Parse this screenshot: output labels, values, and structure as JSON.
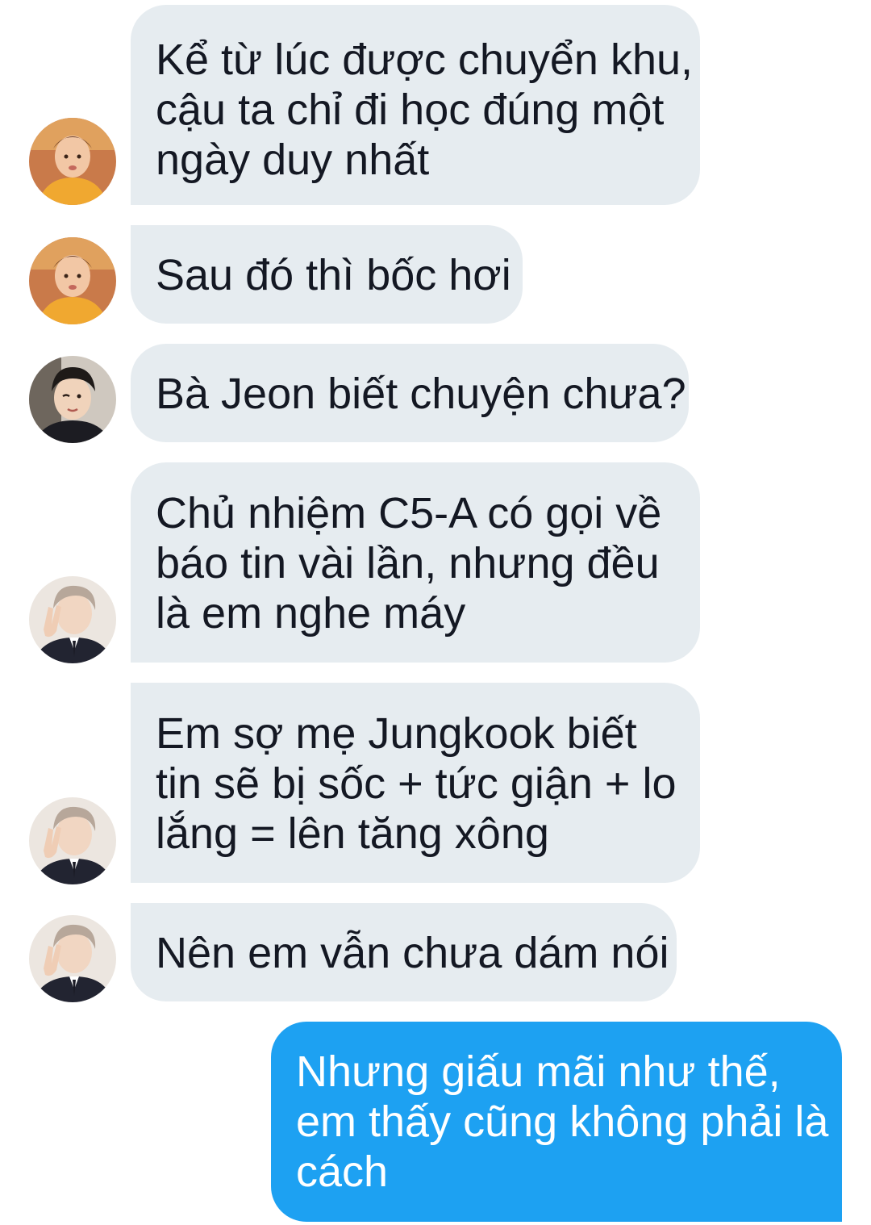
{
  "messages": [
    {
      "sender": "incoming",
      "avatar": "avatar-orange-shirt",
      "text": "Kể từ lúc được chuyển khu,\ncậu ta chỉ đi học đúng một\nngày duy nhất"
    },
    {
      "sender": "incoming",
      "avatar": "avatar-orange-shirt",
      "text": "Sau đó thì bốc hơi"
    },
    {
      "sender": "incoming",
      "avatar": "avatar-dark-hair-wink",
      "text": "Bà Jeon biết chuyện chưa?"
    },
    {
      "sender": "incoming",
      "avatar": "avatar-suit-peace-sign",
      "text": "Chủ nhiệm C5-A có gọi về\nbáo tin vài lần, nhưng đều\nlà em nghe máy"
    },
    {
      "sender": "incoming",
      "avatar": "avatar-suit-peace-sign",
      "text": "Em sợ mẹ Jungkook biết\ntin sẽ bị sốc + tức giận + lo\nlắng = lên tăng xông"
    },
    {
      "sender": "incoming",
      "avatar": "avatar-suit-peace-sign",
      "text": "Nên em vẫn chưa dám nói"
    },
    {
      "sender": "outgoing",
      "text": "Nhưng giấu mãi như thế,\nem thấy cũng không phải là\ncách"
    }
  ],
  "colors": {
    "incoming_bubble": "#e6ecf0",
    "outgoing_bubble": "#1da1f2",
    "incoming_text": "#141823",
    "outgoing_text": "#ffffff"
  }
}
